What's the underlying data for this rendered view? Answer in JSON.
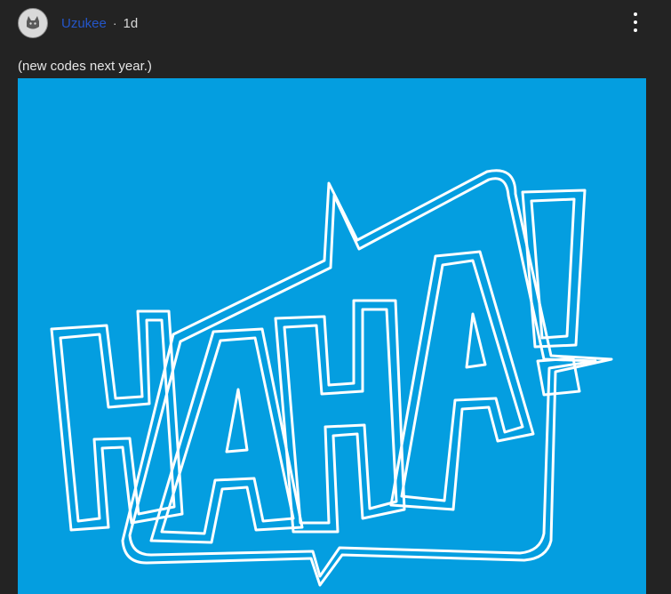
{
  "post": {
    "author": "Uzukee",
    "separator": "·",
    "time": "1d",
    "caption": "(new codes next year.)",
    "menu_icon": "kebab-menu-icon",
    "avatar_icon": "cat-avatar-icon"
  },
  "image": {
    "text": "HAHA!",
    "background": "#049ee0",
    "stroke": "#ffffff"
  }
}
